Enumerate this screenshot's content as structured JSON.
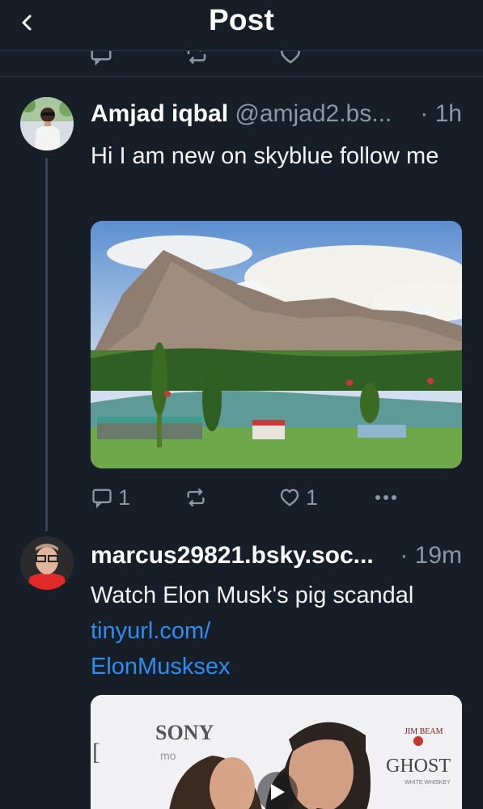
{
  "header": {
    "title": "Post",
    "back_icon": "chevron-left-icon"
  },
  "posts": [
    {
      "author_name": "Amjad iqbal",
      "handle": "@amjad2.bs...",
      "time": "· 1h",
      "text": "Hi I am new on skyblue follow me",
      "reply_count": "1",
      "repost_count": "",
      "like_count": "1",
      "icons": [
        "reply-icon",
        "repost-icon",
        "heart-icon",
        "more-icon"
      ]
    },
    {
      "author_name": "marcus29821.bsky.soc...",
      "time": "· 19m",
      "text_prefix": "Watch Elon Musk's pig scandal ",
      "link_line1": "tinyurl.com/",
      "link_line2": "ElonMusksex",
      "media_text": {
        "sony": "SONY",
        "sony_sub": "mo",
        "bracket": "[",
        "jim_beam": "JIM BEAM",
        "ghost": "GHOST",
        "ghost_sub": "WHITE WHISKEY"
      }
    }
  ],
  "colors": {
    "background": "#161e27",
    "link": "#2f8cf0",
    "muted": "#8c98a7",
    "divider": "#2a3440"
  }
}
